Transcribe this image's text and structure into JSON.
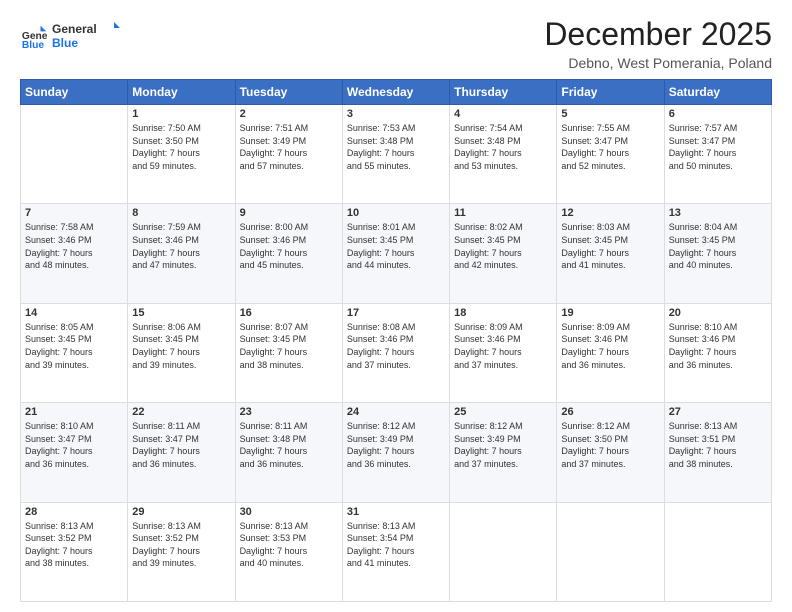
{
  "logo": {
    "general": "General",
    "blue": "Blue"
  },
  "title": "December 2025",
  "subtitle": "Debno, West Pomerania, Poland",
  "days": [
    "Sunday",
    "Monday",
    "Tuesday",
    "Wednesday",
    "Thursday",
    "Friday",
    "Saturday"
  ],
  "weeks": [
    [
      {
        "num": "",
        "info": ""
      },
      {
        "num": "1",
        "info": "Sunrise: 7:50 AM\nSunset: 3:50 PM\nDaylight: 7 hours\nand 59 minutes."
      },
      {
        "num": "2",
        "info": "Sunrise: 7:51 AM\nSunset: 3:49 PM\nDaylight: 7 hours\nand 57 minutes."
      },
      {
        "num": "3",
        "info": "Sunrise: 7:53 AM\nSunset: 3:48 PM\nDaylight: 7 hours\nand 55 minutes."
      },
      {
        "num": "4",
        "info": "Sunrise: 7:54 AM\nSunset: 3:48 PM\nDaylight: 7 hours\nand 53 minutes."
      },
      {
        "num": "5",
        "info": "Sunrise: 7:55 AM\nSunset: 3:47 PM\nDaylight: 7 hours\nand 52 minutes."
      },
      {
        "num": "6",
        "info": "Sunrise: 7:57 AM\nSunset: 3:47 PM\nDaylight: 7 hours\nand 50 minutes."
      }
    ],
    [
      {
        "num": "7",
        "info": "Sunrise: 7:58 AM\nSunset: 3:46 PM\nDaylight: 7 hours\nand 48 minutes."
      },
      {
        "num": "8",
        "info": "Sunrise: 7:59 AM\nSunset: 3:46 PM\nDaylight: 7 hours\nand 47 minutes."
      },
      {
        "num": "9",
        "info": "Sunrise: 8:00 AM\nSunset: 3:46 PM\nDaylight: 7 hours\nand 45 minutes."
      },
      {
        "num": "10",
        "info": "Sunrise: 8:01 AM\nSunset: 3:45 PM\nDaylight: 7 hours\nand 44 minutes."
      },
      {
        "num": "11",
        "info": "Sunrise: 8:02 AM\nSunset: 3:45 PM\nDaylight: 7 hours\nand 42 minutes."
      },
      {
        "num": "12",
        "info": "Sunrise: 8:03 AM\nSunset: 3:45 PM\nDaylight: 7 hours\nand 41 minutes."
      },
      {
        "num": "13",
        "info": "Sunrise: 8:04 AM\nSunset: 3:45 PM\nDaylight: 7 hours\nand 40 minutes."
      }
    ],
    [
      {
        "num": "14",
        "info": "Sunrise: 8:05 AM\nSunset: 3:45 PM\nDaylight: 7 hours\nand 39 minutes."
      },
      {
        "num": "15",
        "info": "Sunrise: 8:06 AM\nSunset: 3:45 PM\nDaylight: 7 hours\nand 39 minutes."
      },
      {
        "num": "16",
        "info": "Sunrise: 8:07 AM\nSunset: 3:45 PM\nDaylight: 7 hours\nand 38 minutes."
      },
      {
        "num": "17",
        "info": "Sunrise: 8:08 AM\nSunset: 3:46 PM\nDaylight: 7 hours\nand 37 minutes."
      },
      {
        "num": "18",
        "info": "Sunrise: 8:09 AM\nSunset: 3:46 PM\nDaylight: 7 hours\nand 37 minutes."
      },
      {
        "num": "19",
        "info": "Sunrise: 8:09 AM\nSunset: 3:46 PM\nDaylight: 7 hours\nand 36 minutes."
      },
      {
        "num": "20",
        "info": "Sunrise: 8:10 AM\nSunset: 3:46 PM\nDaylight: 7 hours\nand 36 minutes."
      }
    ],
    [
      {
        "num": "21",
        "info": "Sunrise: 8:10 AM\nSunset: 3:47 PM\nDaylight: 7 hours\nand 36 minutes."
      },
      {
        "num": "22",
        "info": "Sunrise: 8:11 AM\nSunset: 3:47 PM\nDaylight: 7 hours\nand 36 minutes."
      },
      {
        "num": "23",
        "info": "Sunrise: 8:11 AM\nSunset: 3:48 PM\nDaylight: 7 hours\nand 36 minutes."
      },
      {
        "num": "24",
        "info": "Sunrise: 8:12 AM\nSunset: 3:49 PM\nDaylight: 7 hours\nand 36 minutes."
      },
      {
        "num": "25",
        "info": "Sunrise: 8:12 AM\nSunset: 3:49 PM\nDaylight: 7 hours\nand 37 minutes."
      },
      {
        "num": "26",
        "info": "Sunrise: 8:12 AM\nSunset: 3:50 PM\nDaylight: 7 hours\nand 37 minutes."
      },
      {
        "num": "27",
        "info": "Sunrise: 8:13 AM\nSunset: 3:51 PM\nDaylight: 7 hours\nand 38 minutes."
      }
    ],
    [
      {
        "num": "28",
        "info": "Sunrise: 8:13 AM\nSunset: 3:52 PM\nDaylight: 7 hours\nand 38 minutes."
      },
      {
        "num": "29",
        "info": "Sunrise: 8:13 AM\nSunset: 3:52 PM\nDaylight: 7 hours\nand 39 minutes."
      },
      {
        "num": "30",
        "info": "Sunrise: 8:13 AM\nSunset: 3:53 PM\nDaylight: 7 hours\nand 40 minutes."
      },
      {
        "num": "31",
        "info": "Sunrise: 8:13 AM\nSunset: 3:54 PM\nDaylight: 7 hours\nand 41 minutes."
      },
      {
        "num": "",
        "info": ""
      },
      {
        "num": "",
        "info": ""
      },
      {
        "num": "",
        "info": ""
      }
    ]
  ]
}
